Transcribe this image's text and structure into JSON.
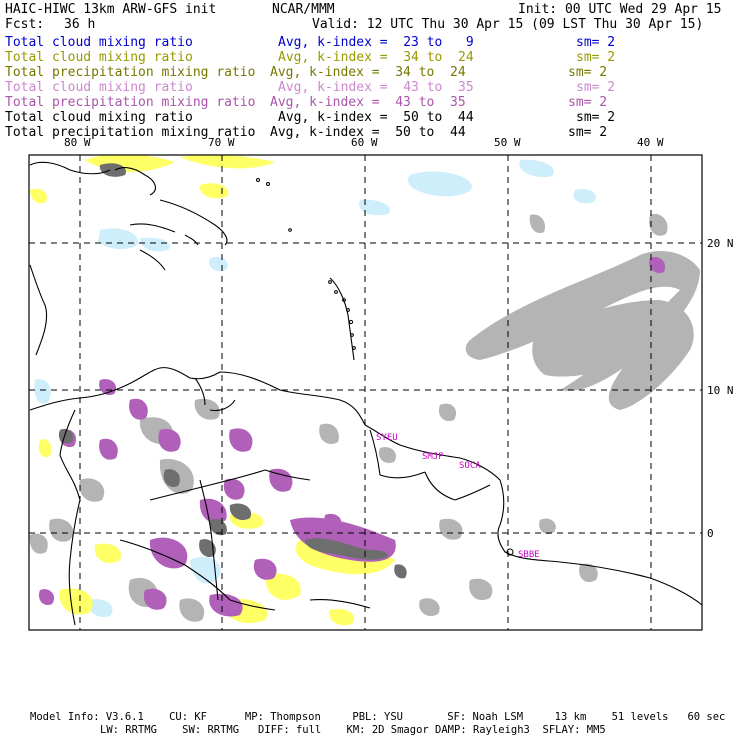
{
  "header": {
    "title": "HAIC-HIWC 13km ARW-GFS init",
    "center": "NCAR/MMM",
    "init": "Init: 00 UTC Wed 29 Apr 15",
    "fcst_label": "Fcst:",
    "fcst_value": "36 h",
    "valid": "Valid: 12 UTC Thu 30 Apr 15 (09 LST Thu 30 Apr 15)"
  },
  "legend": [
    {
      "field": "Total cloud mixing ratio",
      "avg": "Avg, k-index =  23 to   9",
      "sm": "sm= 2",
      "color": "#0000cc"
    },
    {
      "field": "Total cloud mixing ratio",
      "avg": "Avg, k-index =  34 to  24",
      "sm": "sm= 2",
      "color": "#999900"
    },
    {
      "field": "Total precipitation mixing ratio",
      "avg": "Avg, k-index =  34 to  24",
      "sm": "sm= 2",
      "color": "#777700"
    },
    {
      "field": "Total cloud mixing ratio",
      "avg": "Avg, k-index =  43 to  35",
      "sm": "sm= 2",
      "color": "#cc88cc"
    },
    {
      "field": "Total precipitation mixing ratio",
      "avg": "Avg, k-index =  43 to  35",
      "sm": "sm= 2",
      "color": "#aa55aa"
    },
    {
      "field": "Total cloud mixing ratio",
      "avg": "Avg, k-index =  50 to  44",
      "sm": "sm= 2",
      "color": "#000000"
    },
    {
      "field": "Total precipitation mixing ratio",
      "avg": "Avg, k-index =  50 to  44",
      "sm": "sm= 2",
      "color": "#000000"
    }
  ],
  "axes": {
    "lon_labels": [
      "80 W",
      "70 W",
      "60 W",
      "50 W",
      "40 W"
    ],
    "lat_labels": [
      "20 N",
      "10 N",
      "0"
    ]
  },
  "stations": [
    "SYEU",
    "SMJP",
    "SOCA",
    "SBBE"
  ],
  "colors": {
    "light_cyan": "#cdeefa",
    "yellow": "#ffff66",
    "gray": "#b4b4b4",
    "dark_gray": "#6e6e6e",
    "purple": "#b060b8",
    "station_magenta": "#cc00cc",
    "coast": "#000000"
  },
  "footer": {
    "line1": "Model Info: V3.6.1    CU: KF      MP: Thompson     PBL: YSU       SF: Noah LSM     13 km    51 levels   60 sec",
    "line2": "LW: RRTMG    SW: RRTMG   DIFF: full    KM: 2D Smagor DAMP: Rayleigh3  SFLAY: MM5"
  }
}
